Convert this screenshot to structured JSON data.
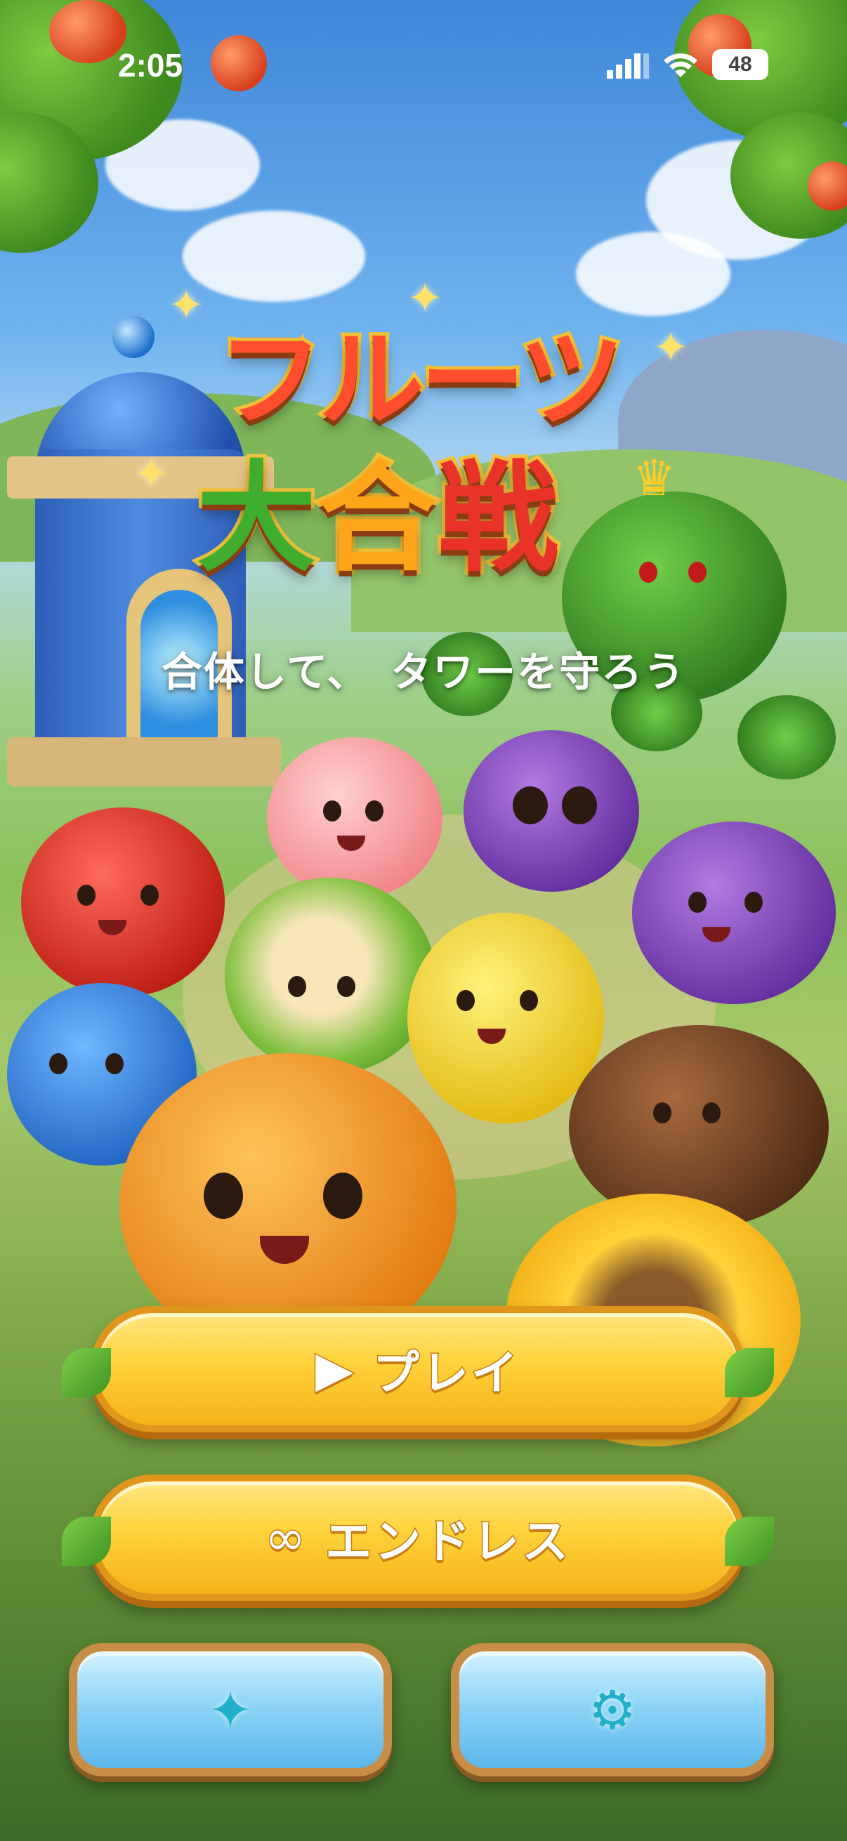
{
  "status_bar": {
    "time": "2:05",
    "battery": "48"
  },
  "title": {
    "line1": "フルーツ",
    "line2_chars": [
      "大",
      "合",
      "戦"
    ]
  },
  "subtitle": "合体して、　タワーを守ろう",
  "buttons": {
    "play": {
      "label": "プレイ",
      "icon": "play-triangle-icon",
      "glyph": "▶"
    },
    "endless": {
      "label": "エンドレス",
      "icon": "infinity-icon",
      "glyph": "∞"
    },
    "collection": {
      "icon": "sparkle-icon",
      "glyph": "✦"
    },
    "settings": {
      "icon": "gear-icon",
      "glyph": "⚙"
    }
  },
  "colors": {
    "primary_button": "#ffd23a",
    "primary_border": "#e0961b",
    "secondary_button": "#8fd4f7",
    "secondary_border": "#c98e46",
    "secondary_icon": "#1fb1c9"
  }
}
